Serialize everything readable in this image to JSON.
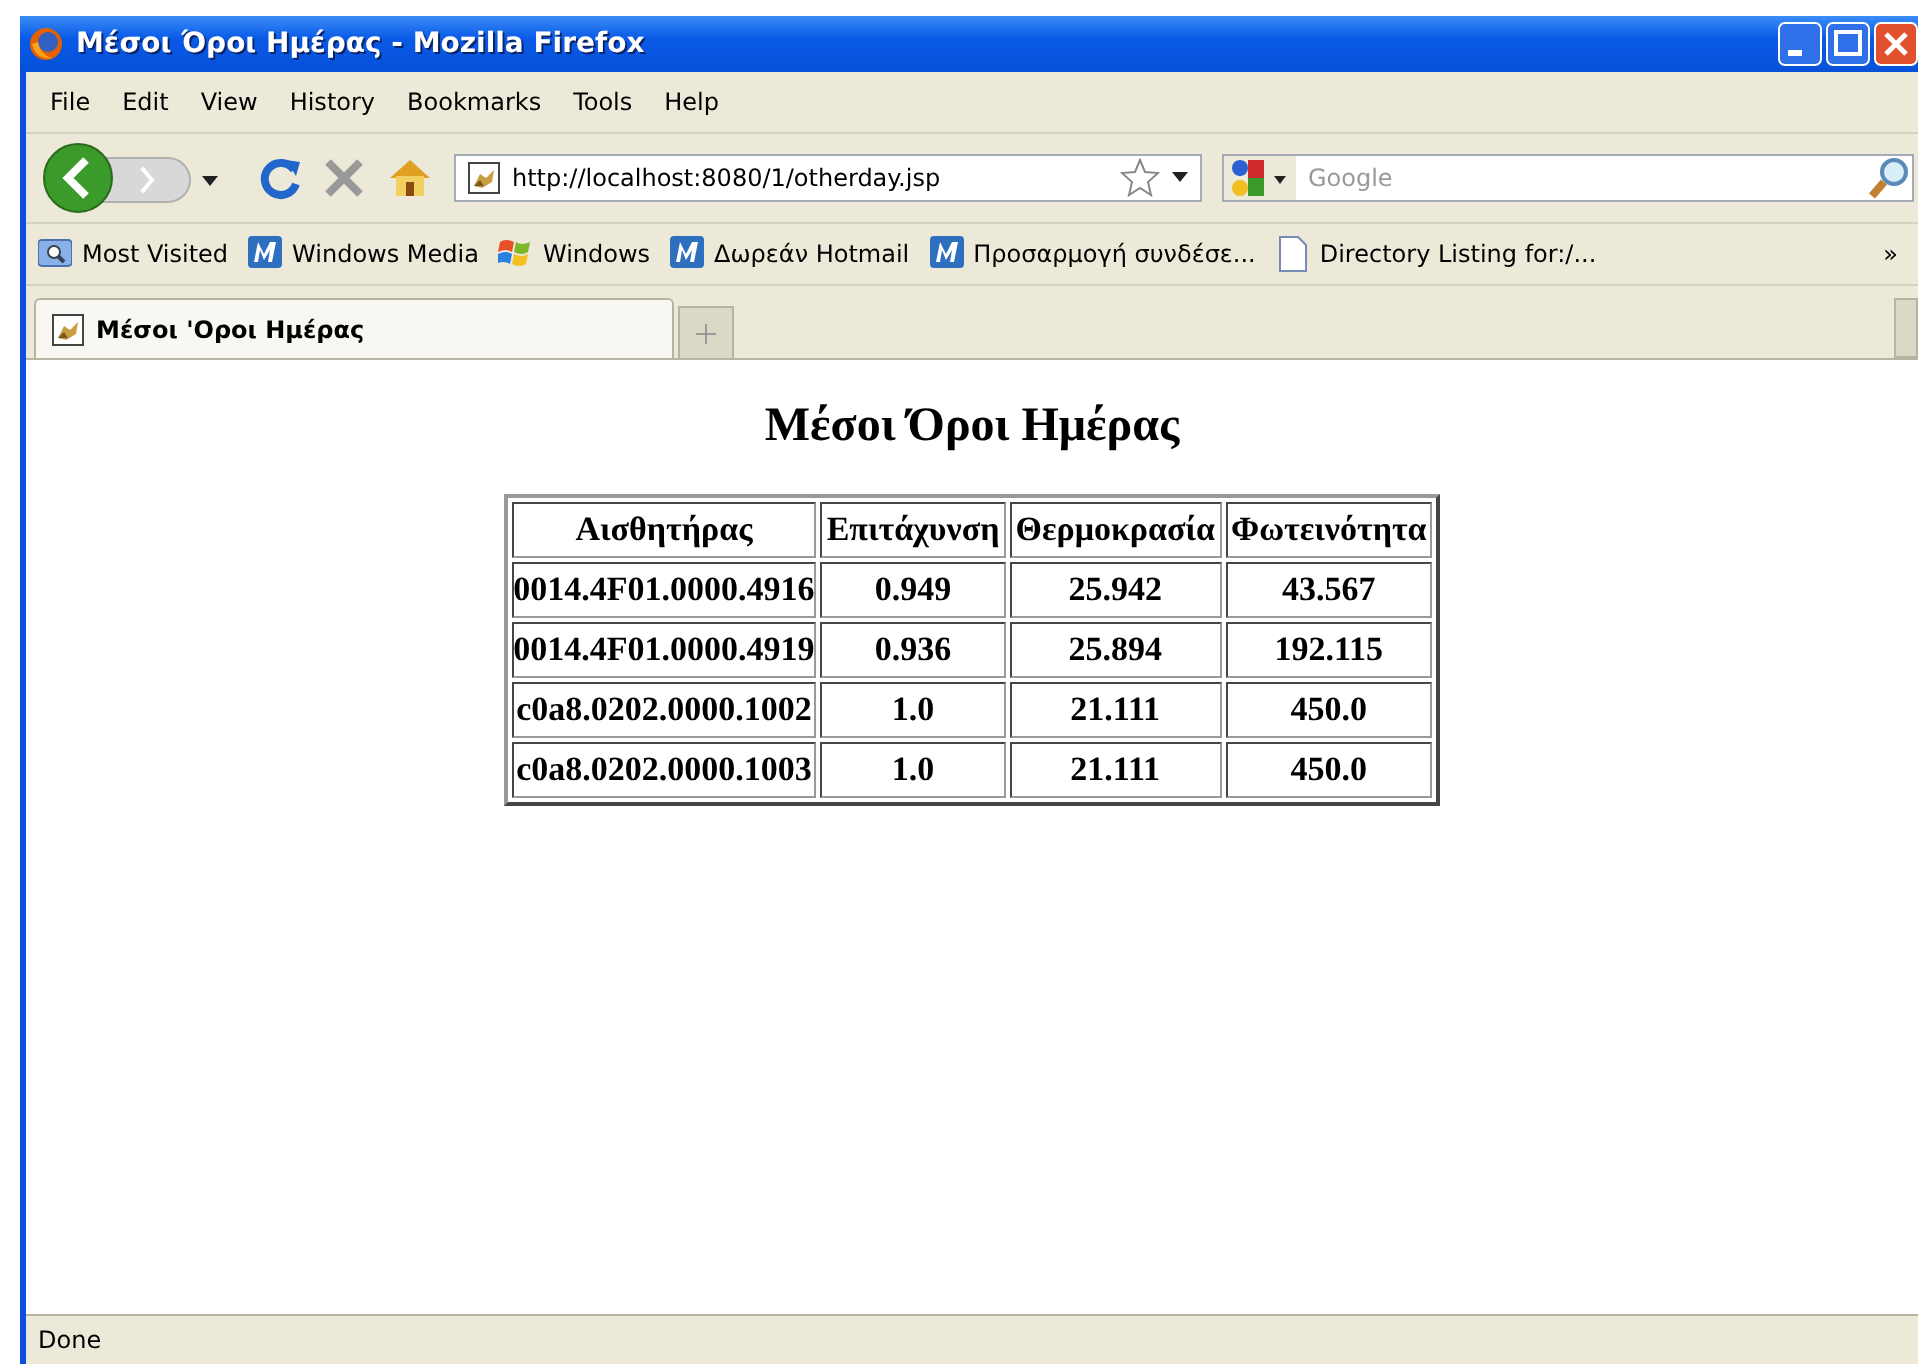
{
  "window": {
    "title": "Μέσοι Όροι Ημέρας - Mozilla Firefox"
  },
  "menu": [
    "File",
    "Edit",
    "View",
    "History",
    "Bookmarks",
    "Tools",
    "Help"
  ],
  "address": {
    "value": "http://localhost:8080/1/otherday.jsp"
  },
  "search": {
    "placeholder": "Google"
  },
  "bookmarks": [
    {
      "label": "Most Visited",
      "kind": "smart"
    },
    {
      "label": "Windows Media",
      "kind": "m"
    },
    {
      "label": "Windows",
      "kind": "flag"
    },
    {
      "label": "Δωρεάν Hotmail",
      "kind": "m"
    },
    {
      "label": "Προσαρμογή συνδέσε...",
      "kind": "m"
    },
    {
      "label": "Directory Listing for:/...",
      "kind": "page"
    }
  ],
  "bookmarks_overflow": "»",
  "tabs": [
    {
      "label": "Μέσοι 'Οροι Ημέρας",
      "selected": true
    }
  ],
  "page": {
    "heading": "Μέσοι Όροι Ημέρας",
    "table": {
      "columns": [
        "Αισθητήρας",
        "Επιτάχυνση",
        "Θερμοκρασία",
        "Φωτεινότητα"
      ],
      "rows": [
        [
          "0014.4F01.0000.4916",
          "0.949",
          "25.942",
          "43.567"
        ],
        [
          "0014.4F01.0000.4919",
          "0.936",
          "25.894",
          "192.115"
        ],
        [
          "c0a8.0202.0000.1002",
          "1.0",
          "21.111",
          "450.0"
        ],
        [
          "c0a8.0202.0000.1003",
          "1.0",
          "21.111",
          "450.0"
        ]
      ]
    }
  },
  "status_bar": "Done"
}
